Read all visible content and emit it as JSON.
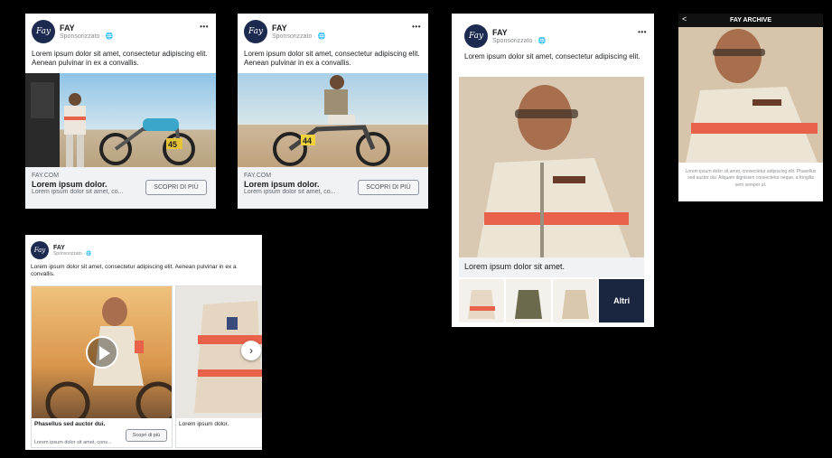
{
  "brand": {
    "name": "FAY",
    "logo_text": "Fay",
    "sponsored": "Sponsorizzato · 🌐"
  },
  "card1": {
    "text": "Lorem ipsum dolor sit amet, consectetur adipiscing elit. Aenean pulvinar in ex a convallis.",
    "domain": "FAY.COM",
    "headline": "Lorem ipsum dolor.",
    "description": "Lorem ipsum dolor sit amet, co...",
    "cta": "SCOPRI DI PIÙ",
    "more": "•••"
  },
  "card2": {
    "text": "Lorem ipsum dolor sit amet, consectetur adipiscing elit. Aenean pulvinar in ex a convallis.",
    "domain": "FAY.COM",
    "headline": "Lorem ipsum dolor.",
    "description": "Lorem ipsum dolor sit amet, co...",
    "cta": "SCOPRI DI PIÙ",
    "more": "•••"
  },
  "card3": {
    "text": "Lorem ipsum dolor sit amet, consectetur adipiscing elit.",
    "caption": "Lorem ipsum dolor sit amet.",
    "more_label": "Altri",
    "more": "•••"
  },
  "story": {
    "title": "FAY ARCHIVE",
    "back": "<",
    "text": "Lorem ipsum dolor sit amet, consectetur adipiscing elit. Phasellus sed auctor dui. Aliquam dignissim consectetur neque, a fringilla sem semper ut."
  },
  "card5": {
    "text": "Lorem ipsum dolor sit amet, consectetur adipiscing elit. Aenean pulvinar in ex a convallis.",
    "item1_title": "Phasellus sed auctor dui.",
    "item1_desc": "Lorem ipsum dolor sit amet, cons...",
    "item1_cta": "Scopri di più",
    "item2_title": "Lorem ipsum dolor."
  },
  "colors": {
    "accent": "#1c2a4f",
    "stripe": "#e8614a"
  }
}
